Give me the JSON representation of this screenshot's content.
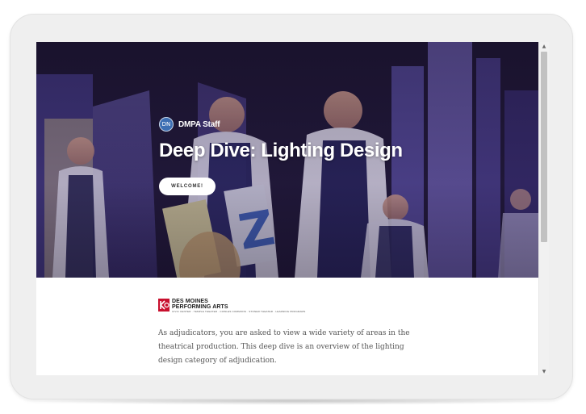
{
  "author": {
    "initials": "DN",
    "name": "DMPA Staff"
  },
  "hero": {
    "title": "Deep Dive: Lighting Design",
    "button_label": "WELCOME!"
  },
  "logo": {
    "line1": "DES MOINES",
    "line2": "PERFORMING ARTS",
    "tagline": "CIVIC CENTER · TEMPLE THEATER · COWLES COMMONS · STONER THEATER · LEARNING PROGRAMS",
    "brand_color": "#c8102e"
  },
  "body": {
    "paragraph": "As adjudicators, you are asked to view a wide variety of  areas in the theatrical production. This deep dive is an overview of the lighting design category of adjudication."
  },
  "scrollbar": {
    "up_icon": "▲",
    "down_icon": "▼"
  },
  "colors": {
    "hero_tint": "#2c2150",
    "avatar": "#3d6fb3"
  }
}
